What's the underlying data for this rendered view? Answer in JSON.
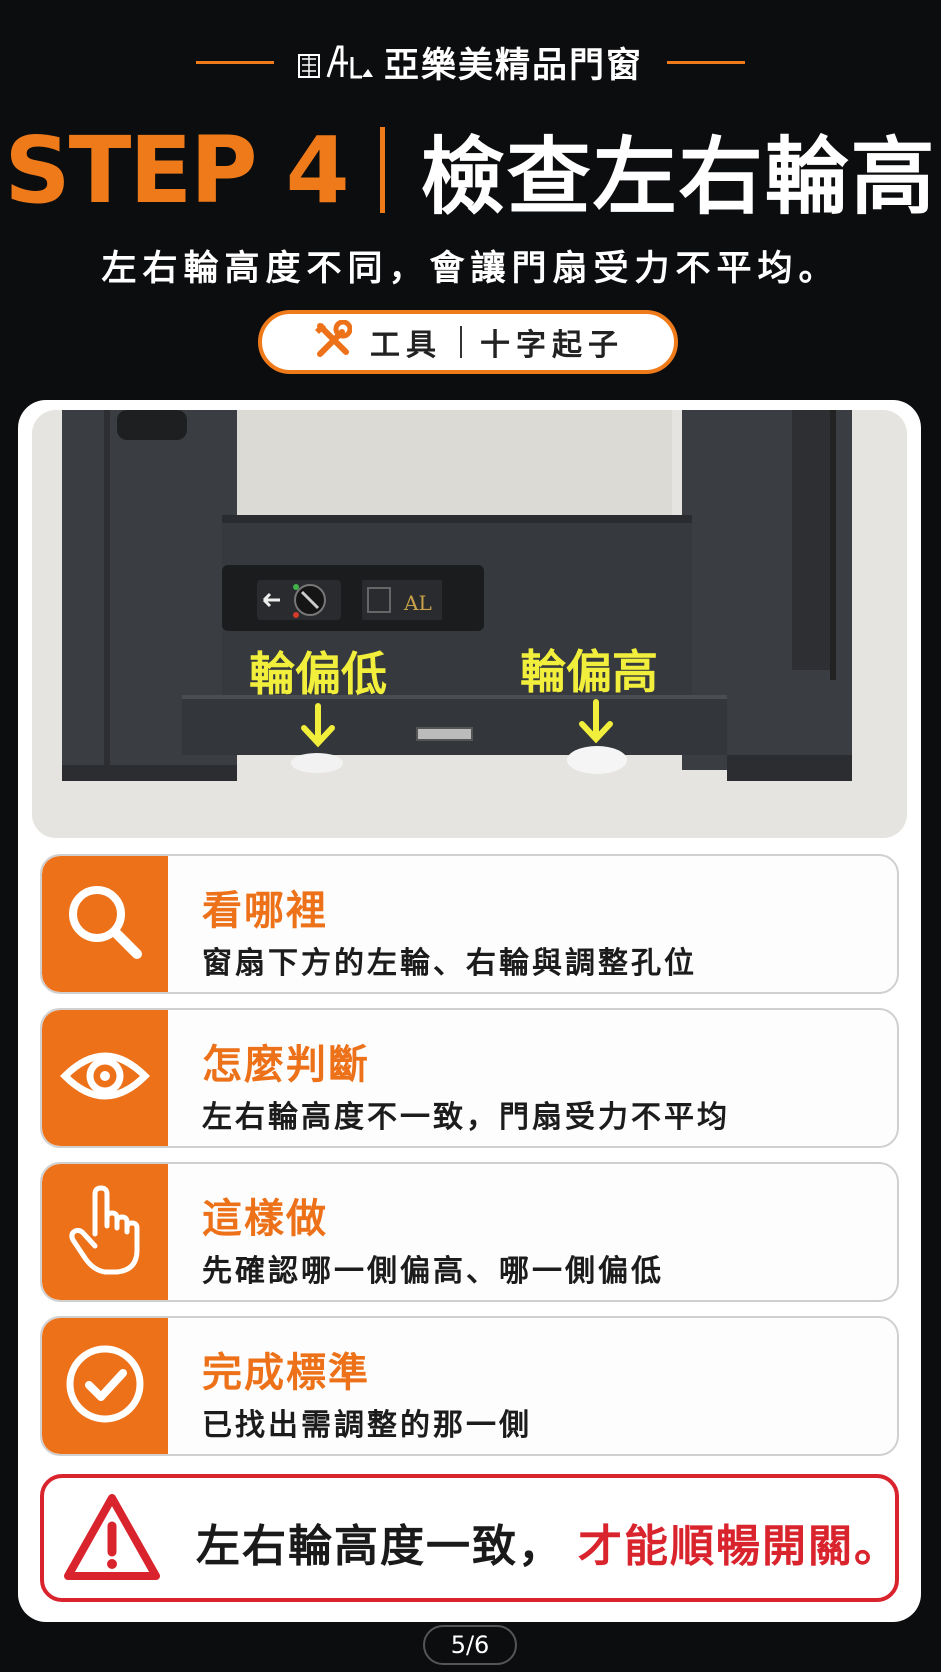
{
  "brand": {
    "line_color": "#ef7a1a",
    "logo_icon": "ala-logo-icon",
    "name": "亞樂美精品門窗"
  },
  "step": {
    "label": "STEP 4",
    "title": "檢查左右輪高"
  },
  "subtitle": "左右輪高度不同，會讓門扇受力不平均。",
  "tool": {
    "icon": "tools-icon",
    "label": "工具",
    "value": "十字起子"
  },
  "photo": {
    "label_low": "輪偏低",
    "label_high": "輪偏高",
    "arrow_color": "#f2ee3c",
    "panel_logo": "AL"
  },
  "checklist": [
    {
      "icon": "magnifier-icon",
      "title": "看哪裡",
      "desc": "窗扇下方的左輪、右輪與調整孔位"
    },
    {
      "icon": "eye-icon",
      "title": "怎麼判斷",
      "desc": "左右輪高度不一致，門扇受力不平均"
    },
    {
      "icon": "hand-pointer-icon",
      "title": "這樣做",
      "desc": "先確認哪一側偏高、哪一側偏低"
    },
    {
      "icon": "check-circle-icon",
      "title": "完成標準",
      "desc": "已找出需調整的那一側"
    }
  ],
  "warning": {
    "icon": "warning-triangle-icon",
    "text": "左右輪高度一致，",
    "highlight": "才能順暢開關。"
  },
  "page_indicator": "5/6",
  "colors": {
    "accent": "#ec7119",
    "alert": "#d9232d",
    "background": "#0c0d0f"
  }
}
